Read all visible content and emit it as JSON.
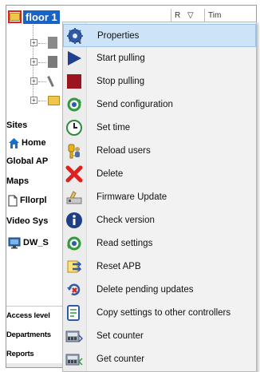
{
  "tree": {
    "selected_node_label": "floor 1",
    "column_header_1": "R",
    "column_header_2": "Tim"
  },
  "left_panel": {
    "sites_label": "Sites",
    "home_label": "Home",
    "global_label": "Global AP",
    "maps_label": "Maps",
    "floorplan_label": "Fllorpl",
    "video_label": "Video Sys",
    "dw_label": "DW_S",
    "access_levels_label": "Access level",
    "departments_label": "Departments",
    "reports_label": "Reports"
  },
  "context_menu": {
    "items": [
      {
        "label": "Properties",
        "icon": "gear-properties-icon"
      },
      {
        "label": "Start pulling",
        "icon": "play-icon"
      },
      {
        "label": "Stop pulling",
        "icon": "stop-icon"
      },
      {
        "label": "Send configuration",
        "icon": "gear-refresh-icon"
      },
      {
        "label": "Set time",
        "icon": "clock-icon"
      },
      {
        "label": "Reload users",
        "icon": "key-user-icon"
      },
      {
        "label": "Delete",
        "icon": "red-x-icon"
      },
      {
        "label": "Firmware Update",
        "icon": "firmware-icon"
      },
      {
        "label": "Check version",
        "icon": "info-icon"
      },
      {
        "label": "Read settings",
        "icon": "gear-read-icon"
      },
      {
        "label": "Reset APB",
        "icon": "reset-apb-icon"
      },
      {
        "label": "Delete pending updates",
        "icon": "delete-pending-icon"
      },
      {
        "label": "Copy settings to other controllers",
        "icon": "copy-settings-icon"
      },
      {
        "label": "Set counter",
        "icon": "set-counter-icon"
      },
      {
        "label": "Get counter",
        "icon": "get-counter-icon"
      }
    ]
  },
  "colors": {
    "highlight": "#cde3f8",
    "selection_blue": "#1a63c6",
    "play_blue": "#1f3f8f",
    "stop_red": "#9b1420",
    "delete_red": "#e02020"
  }
}
